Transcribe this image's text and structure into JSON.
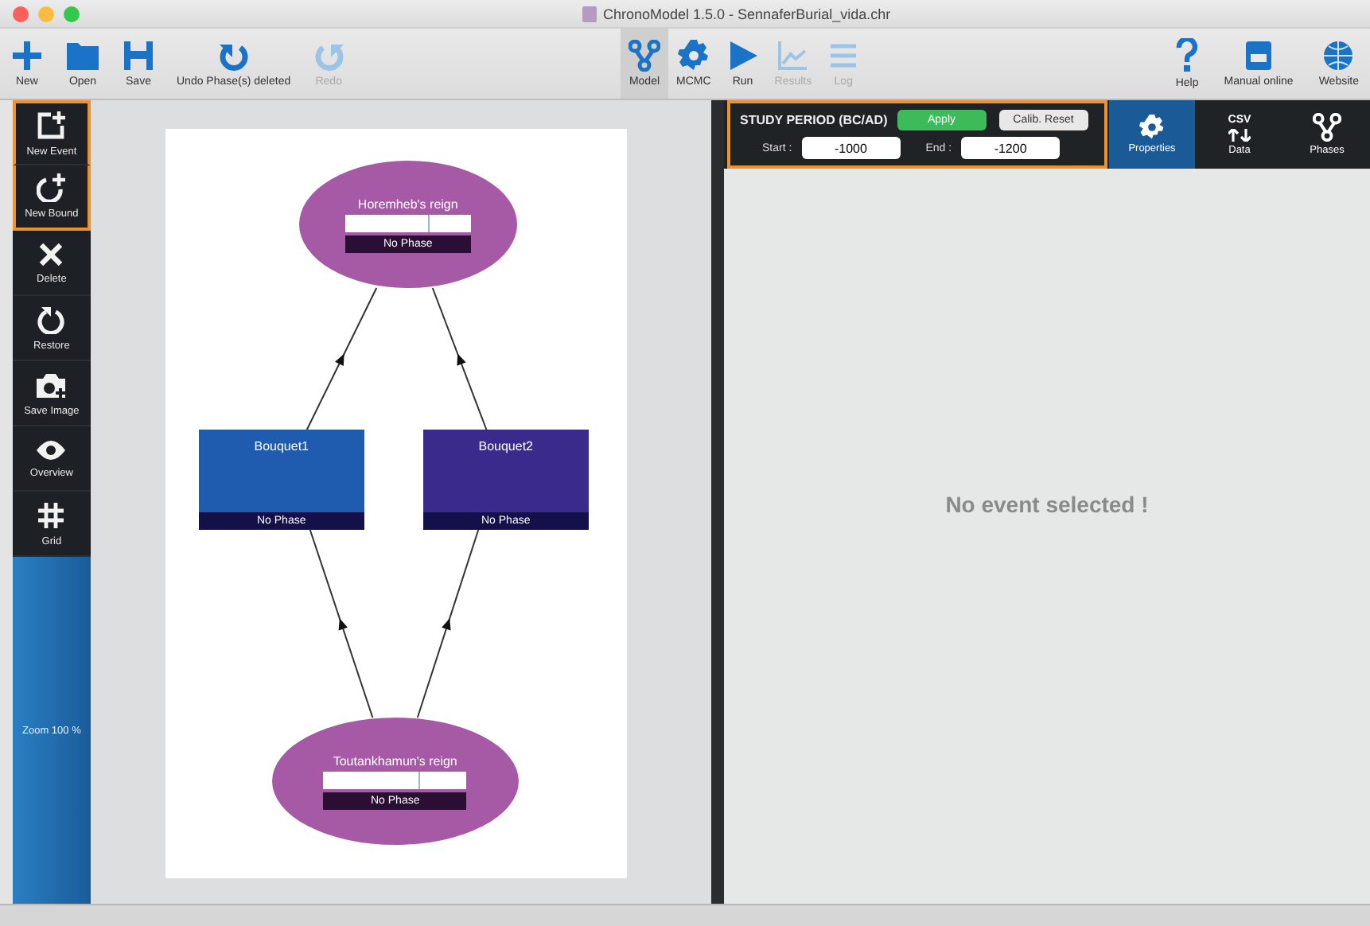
{
  "window": {
    "title": "ChronoModel 1.5.0 - SennaferBurial_vida.chr"
  },
  "toolbar": {
    "left": [
      {
        "label": "New",
        "disabled": false
      },
      {
        "label": "Open",
        "disabled": false
      },
      {
        "label": "Save",
        "disabled": false
      },
      {
        "label": "Undo Phase(s) deleted",
        "disabled": false
      },
      {
        "label": "Redo",
        "disabled": true
      }
    ],
    "modes": [
      {
        "label": "Model",
        "selected": true,
        "disabled": false
      },
      {
        "label": "MCMC",
        "selected": false,
        "disabled": false
      },
      {
        "label": "Run",
        "selected": false,
        "disabled": false
      },
      {
        "label": "Results",
        "selected": false,
        "disabled": true
      },
      {
        "label": "Log",
        "selected": false,
        "disabled": true
      }
    ],
    "right": [
      {
        "label": "Help"
      },
      {
        "label": "Manual online"
      },
      {
        "label": "Website"
      }
    ]
  },
  "tools": [
    {
      "label": "New Event",
      "highlighted": true
    },
    {
      "label": "New Bound",
      "highlighted": true
    },
    {
      "label": "Delete",
      "highlighted": false
    },
    {
      "label": "Restore",
      "highlighted": false
    },
    {
      "label": "Save Image",
      "highlighted": false
    },
    {
      "label": "Overview",
      "highlighted": false
    },
    {
      "label": "Grid",
      "highlighted": false
    }
  ],
  "zoom_label": "Zoom 100 %",
  "diagram": {
    "nodes": [
      {
        "kind": "bound",
        "name": "Horemheb's reign",
        "phase": "No Phase",
        "color": "#a65aa5"
      },
      {
        "kind": "event",
        "name": "Bouquet1",
        "phase": "No Phase",
        "color": "#1f5cb0"
      },
      {
        "kind": "event",
        "name": "Bouquet2",
        "phase": "No Phase",
        "color": "#3a2a8c"
      },
      {
        "kind": "bound",
        "name": "Toutankhamun's reign",
        "phase": "No Phase",
        "color": "#a65aa5"
      }
    ]
  },
  "study_period": {
    "title": "STUDY PERIOD (BC/AD)",
    "highlighted": true,
    "apply": "Apply",
    "reset": "Calib. Reset",
    "start_label": "Start :",
    "start": "-1000",
    "end_label": "End :",
    "end": "-1200"
  },
  "tabs": [
    {
      "label": "Properties",
      "selected": true
    },
    {
      "label": "Data",
      "icon_text": "CSV",
      "selected": false
    },
    {
      "label": "Phases",
      "selected": false
    }
  ],
  "message": "No event selected !"
}
